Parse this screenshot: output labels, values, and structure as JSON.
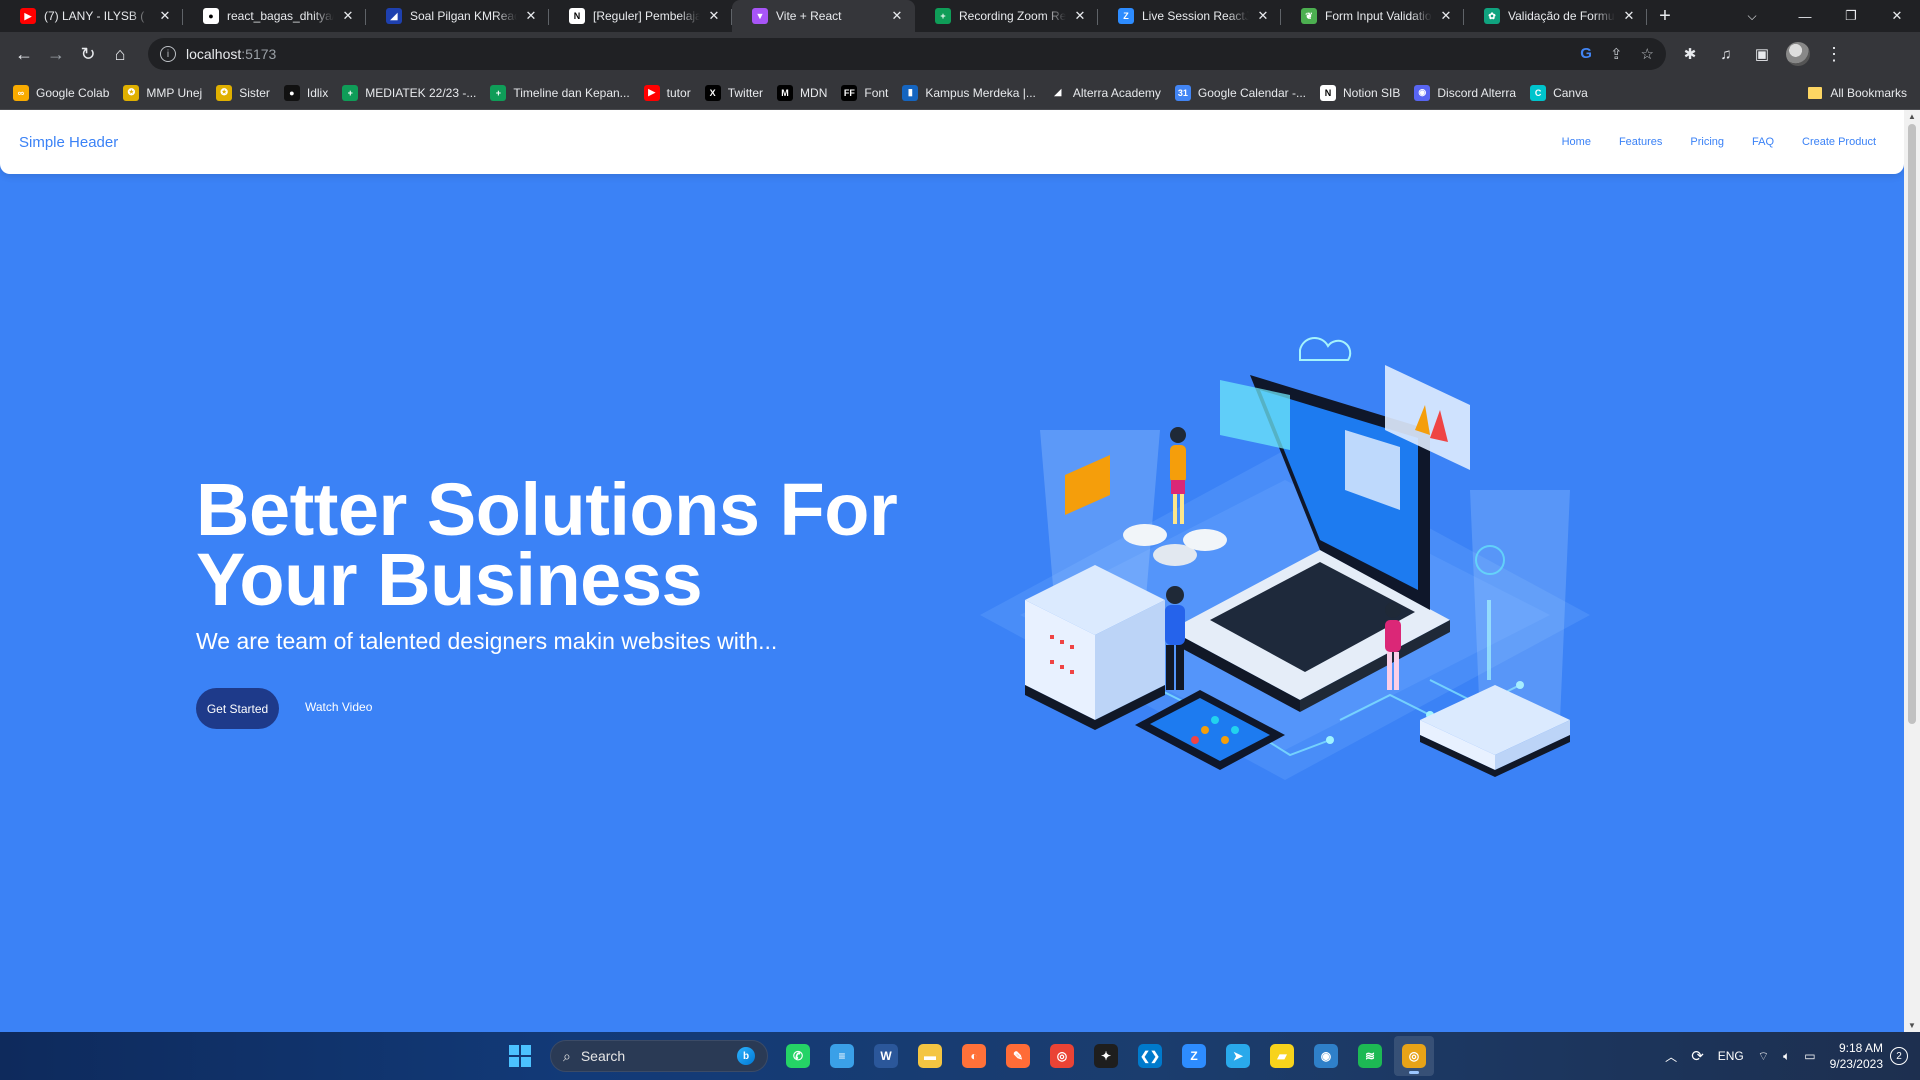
{
  "browser": {
    "tabs": [
      {
        "title": "(7) LANY - ILYSB (",
        "favicon": "youtube-icon",
        "color": "#ff0000",
        "glyph": "▶"
      },
      {
        "title": "react_bagas_dhitya/l",
        "favicon": "github-icon",
        "color": "#ffffff",
        "glyph": "●"
      },
      {
        "title": "Soal Pilgan KMReact -",
        "favicon": "alterra-icon",
        "color": "#1e40af",
        "glyph": "◢"
      },
      {
        "title": "[Reguler] Pembelajara",
        "favicon": "notion-icon",
        "color": "#ffffff",
        "glyph": "N"
      },
      {
        "title": "Vite + React",
        "favicon": "vite-icon",
        "color": "#a855f7",
        "glyph": "▼"
      },
      {
        "title": "Recording Zoom Rea",
        "favicon": "sheets-icon",
        "color": "#0f9d58",
        "glyph": "+"
      },
      {
        "title": "Live Session ReactJS |",
        "favicon": "zoom-icon",
        "color": "#2d8cff",
        "glyph": "Z"
      },
      {
        "title": "Form Input Validation",
        "favicon": "leaf-icon",
        "color": "#4caf50",
        "glyph": "❦"
      },
      {
        "title": "Validação de Formulá",
        "favicon": "chatgpt-icon",
        "color": "#10a37f",
        "glyph": "✿"
      }
    ],
    "active_tab_index": 4,
    "url_host": "localhost",
    "url_port": ":5173",
    "bookmarks": [
      {
        "label": "Google Colab",
        "icon": "colab-icon",
        "color": "#f9ab00",
        "glyph": "∞"
      },
      {
        "label": "MMP Unej",
        "icon": "unej-icon",
        "color": "#e0b000",
        "glyph": "✪"
      },
      {
        "label": "Sister",
        "icon": "unej-icon",
        "color": "#e0b000",
        "glyph": "✪"
      },
      {
        "label": "Idlix",
        "icon": "idlix-icon",
        "color": "#111111",
        "glyph": "●"
      },
      {
        "label": "MEDIATEK 22/23 -...",
        "icon": "sheets-icon",
        "color": "#0f9d58",
        "glyph": "+"
      },
      {
        "label": "Timeline dan Kepan...",
        "icon": "sheets-icon",
        "color": "#0f9d58",
        "glyph": "+"
      },
      {
        "label": "tutor",
        "icon": "youtube-icon",
        "color": "#ff0000",
        "glyph": "▶"
      },
      {
        "label": "Twitter",
        "icon": "x-icon",
        "color": "#000000",
        "glyph": "X"
      },
      {
        "label": "MDN",
        "icon": "mdn-icon",
        "color": "#000000",
        "glyph": "M"
      },
      {
        "label": "Font",
        "icon": "ff-icon",
        "color": "#000000",
        "glyph": "FF"
      },
      {
        "label": "Kampus Merdeka |...",
        "icon": "kampus-merdeka-icon",
        "color": "#1565c0",
        "glyph": "▮"
      },
      {
        "label": "Alterra Academy",
        "icon": "alterra-icon",
        "color": "#35363a",
        "glyph": "◢"
      },
      {
        "label": "Google Calendar -...",
        "icon": "calendar-icon",
        "color": "#4285f4",
        "glyph": "31"
      },
      {
        "label": "Notion SIB",
        "icon": "notion-icon",
        "color": "#ffffff",
        "glyph": "N"
      },
      {
        "label": "Discord Alterra",
        "icon": "discord-icon",
        "color": "#5865f2",
        "glyph": "◉"
      },
      {
        "label": "Canva",
        "icon": "canva-icon",
        "color": "#00c4cc",
        "glyph": "C"
      }
    ],
    "all_bookmarks_label": "All Bookmarks"
  },
  "page": {
    "brand": "Simple Header",
    "nav": [
      "Home",
      "Features",
      "Pricing",
      "FAQ",
      "Create Product"
    ],
    "hero_title": "Better Solutions For Your Business",
    "hero_subtitle": "We are team of talented designers makin websites with...",
    "primary_button": "Get Started",
    "secondary_button": "Watch Video",
    "accent_color": "#3b82f6",
    "button_color": "#1e3a8a"
  },
  "taskbar": {
    "search_placeholder": "Search",
    "apps": [
      {
        "name": "whatsapp-icon",
        "color": "#25d366",
        "glyph": "✆"
      },
      {
        "name": "notepad-icon",
        "color": "#3aa0e8",
        "glyph": "≡"
      },
      {
        "name": "word-icon",
        "color": "#2b579a",
        "glyph": "W"
      },
      {
        "name": "file-explorer-icon",
        "color": "#f4c542",
        "glyph": "▬"
      },
      {
        "name": "firefox-icon",
        "color": "#ff7139",
        "glyph": "◐"
      },
      {
        "name": "postman-icon",
        "color": "#ff6c37",
        "glyph": "✎"
      },
      {
        "name": "chrome-icon",
        "color": "#ea4335",
        "glyph": "◎"
      },
      {
        "name": "figma-icon",
        "color": "#1e1e1e",
        "glyph": "✦"
      },
      {
        "name": "vscode-icon",
        "color": "#007acc",
        "glyph": "❮❯"
      },
      {
        "name": "zoom-icon",
        "color": "#2d8cff",
        "glyph": "Z"
      },
      {
        "name": "telegram-icon",
        "color": "#29a9eb",
        "glyph": "➤"
      },
      {
        "name": "sticky-notes-icon",
        "color": "#f7d31c",
        "glyph": "▰"
      },
      {
        "name": "camera-icon",
        "color": "#2f80c9",
        "glyph": "◉"
      },
      {
        "name": "spotify-icon",
        "color": "#1db954",
        "glyph": "≋"
      },
      {
        "name": "chrome-dev-icon",
        "color": "#e8a317",
        "glyph": "◎"
      }
    ],
    "active_app_index": 14,
    "language": "ENG",
    "time": "9:18 AM",
    "date": "9/23/2023",
    "notification_count": "2"
  }
}
